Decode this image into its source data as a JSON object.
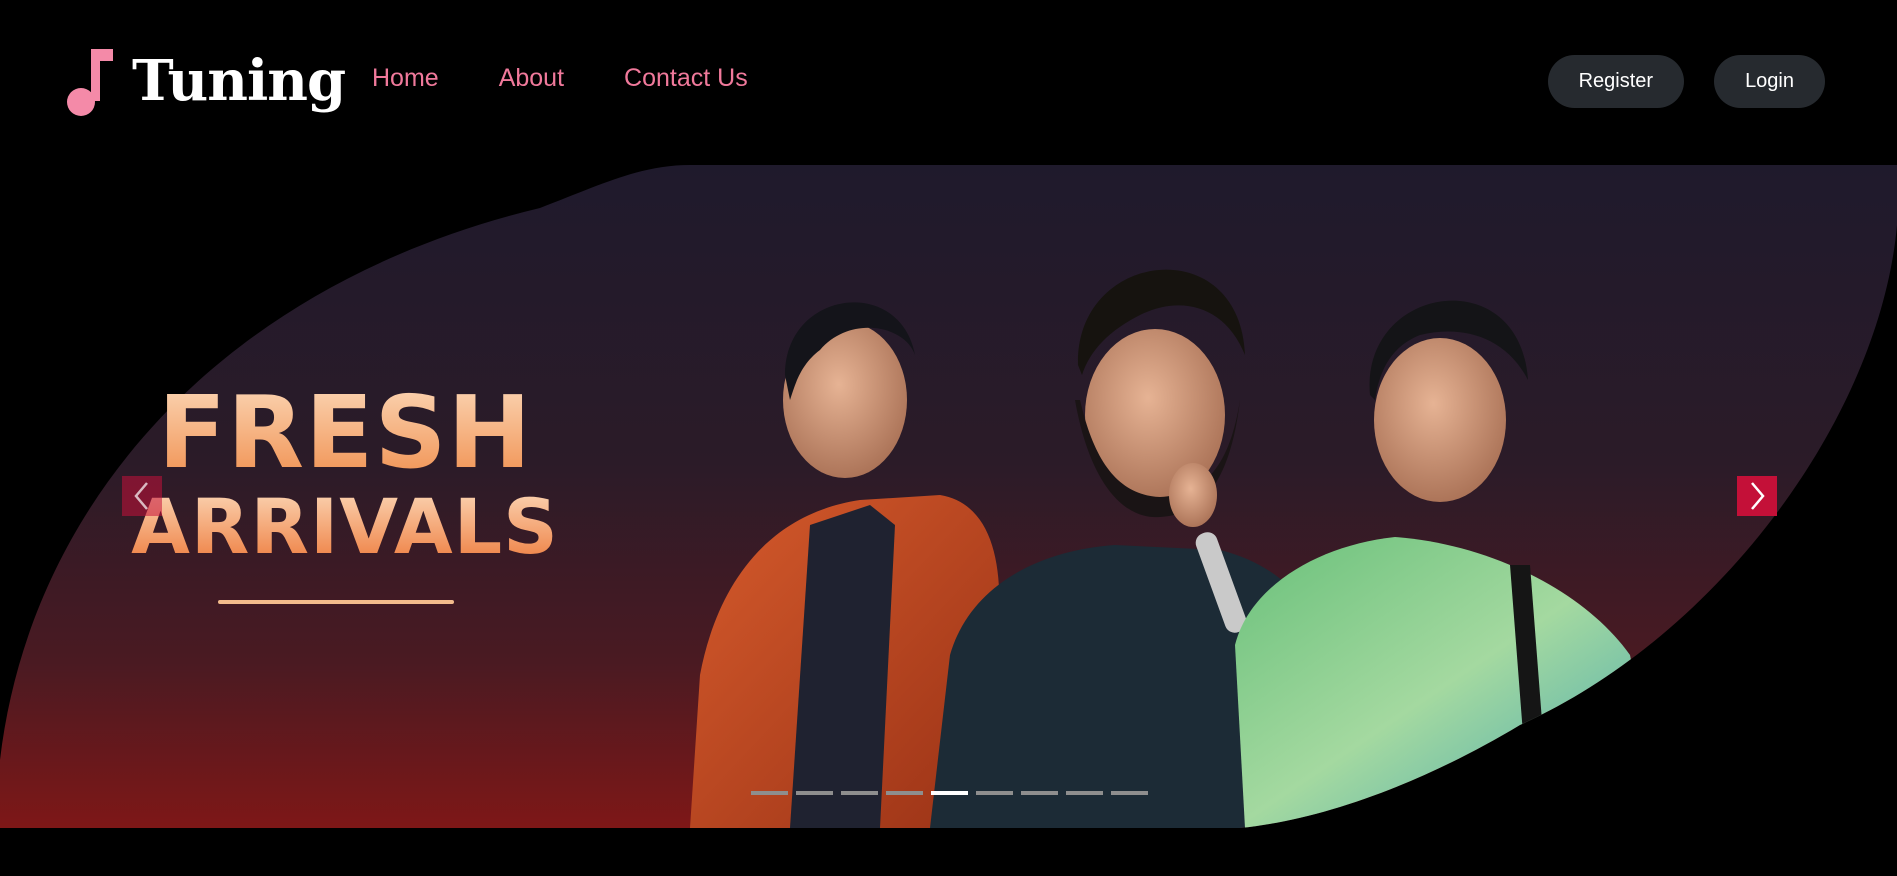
{
  "brand": {
    "name": "Tuning",
    "icon": "music-note-icon",
    "accent_color": "#f48aa8"
  },
  "nav": {
    "home": "Home",
    "about": "About",
    "contact": "Contact Us",
    "link_color": "#f0799b"
  },
  "auth": {
    "register": "Register",
    "login": "Login"
  },
  "hero": {
    "headline_line1": "FRESH",
    "headline_line2": "ARRIVALS",
    "prev_icon": "chevron-left-icon",
    "next_icon": "chevron-right-icon",
    "arrow_color": "#c41038",
    "slide_count": 9,
    "active_slide_index": 4
  }
}
